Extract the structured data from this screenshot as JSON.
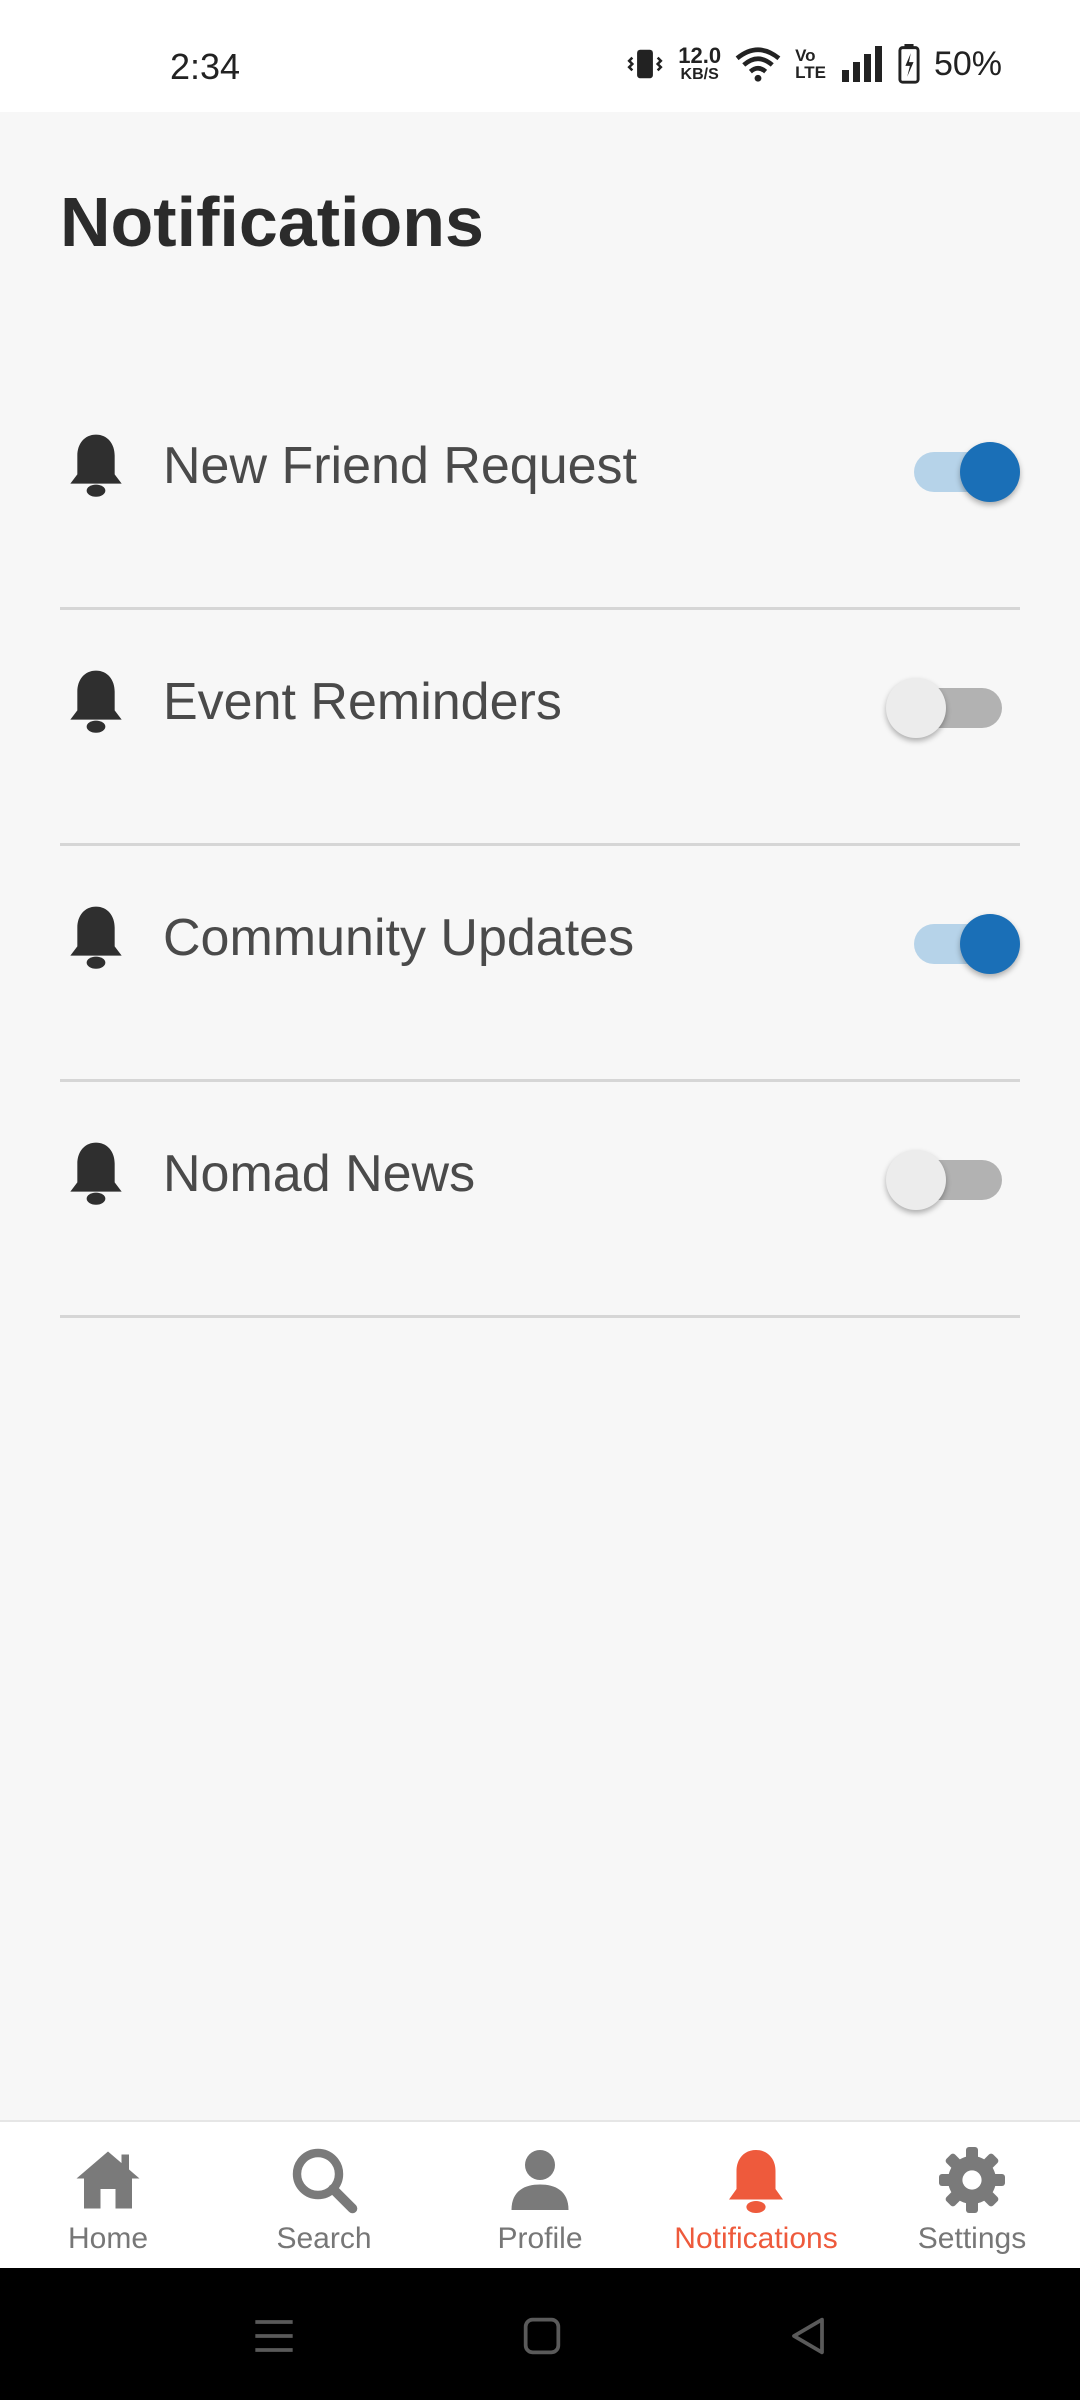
{
  "status_bar": {
    "time": "2:34",
    "net_speed_value": "12.0",
    "net_speed_unit": "KB/S",
    "volte_top": "Vo",
    "volte_bottom": "LTE",
    "battery_percent": "50%"
  },
  "page": {
    "title": "Notifications"
  },
  "settings": [
    {
      "label": "New Friend Request",
      "enabled": true
    },
    {
      "label": "Event Reminders",
      "enabled": false
    },
    {
      "label": "Community Updates",
      "enabled": true
    },
    {
      "label": "Nomad News",
      "enabled": false
    }
  ],
  "bottom_nav": {
    "items": [
      {
        "label": "Home",
        "icon": "home-icon"
      },
      {
        "label": "Search",
        "icon": "search-icon"
      },
      {
        "label": "Profile",
        "icon": "person-icon"
      },
      {
        "label": "Notifications",
        "icon": "bell-icon"
      },
      {
        "label": "Settings",
        "icon": "gear-icon"
      }
    ],
    "active": "Notifications"
  },
  "colors": {
    "accent": "#ee5a3c",
    "toggle_on": "#1a6fb7",
    "toggle_on_track": "#b6d3e9",
    "toggle_off_track": "#b2b2b2",
    "nav_inactive": "#777777"
  }
}
